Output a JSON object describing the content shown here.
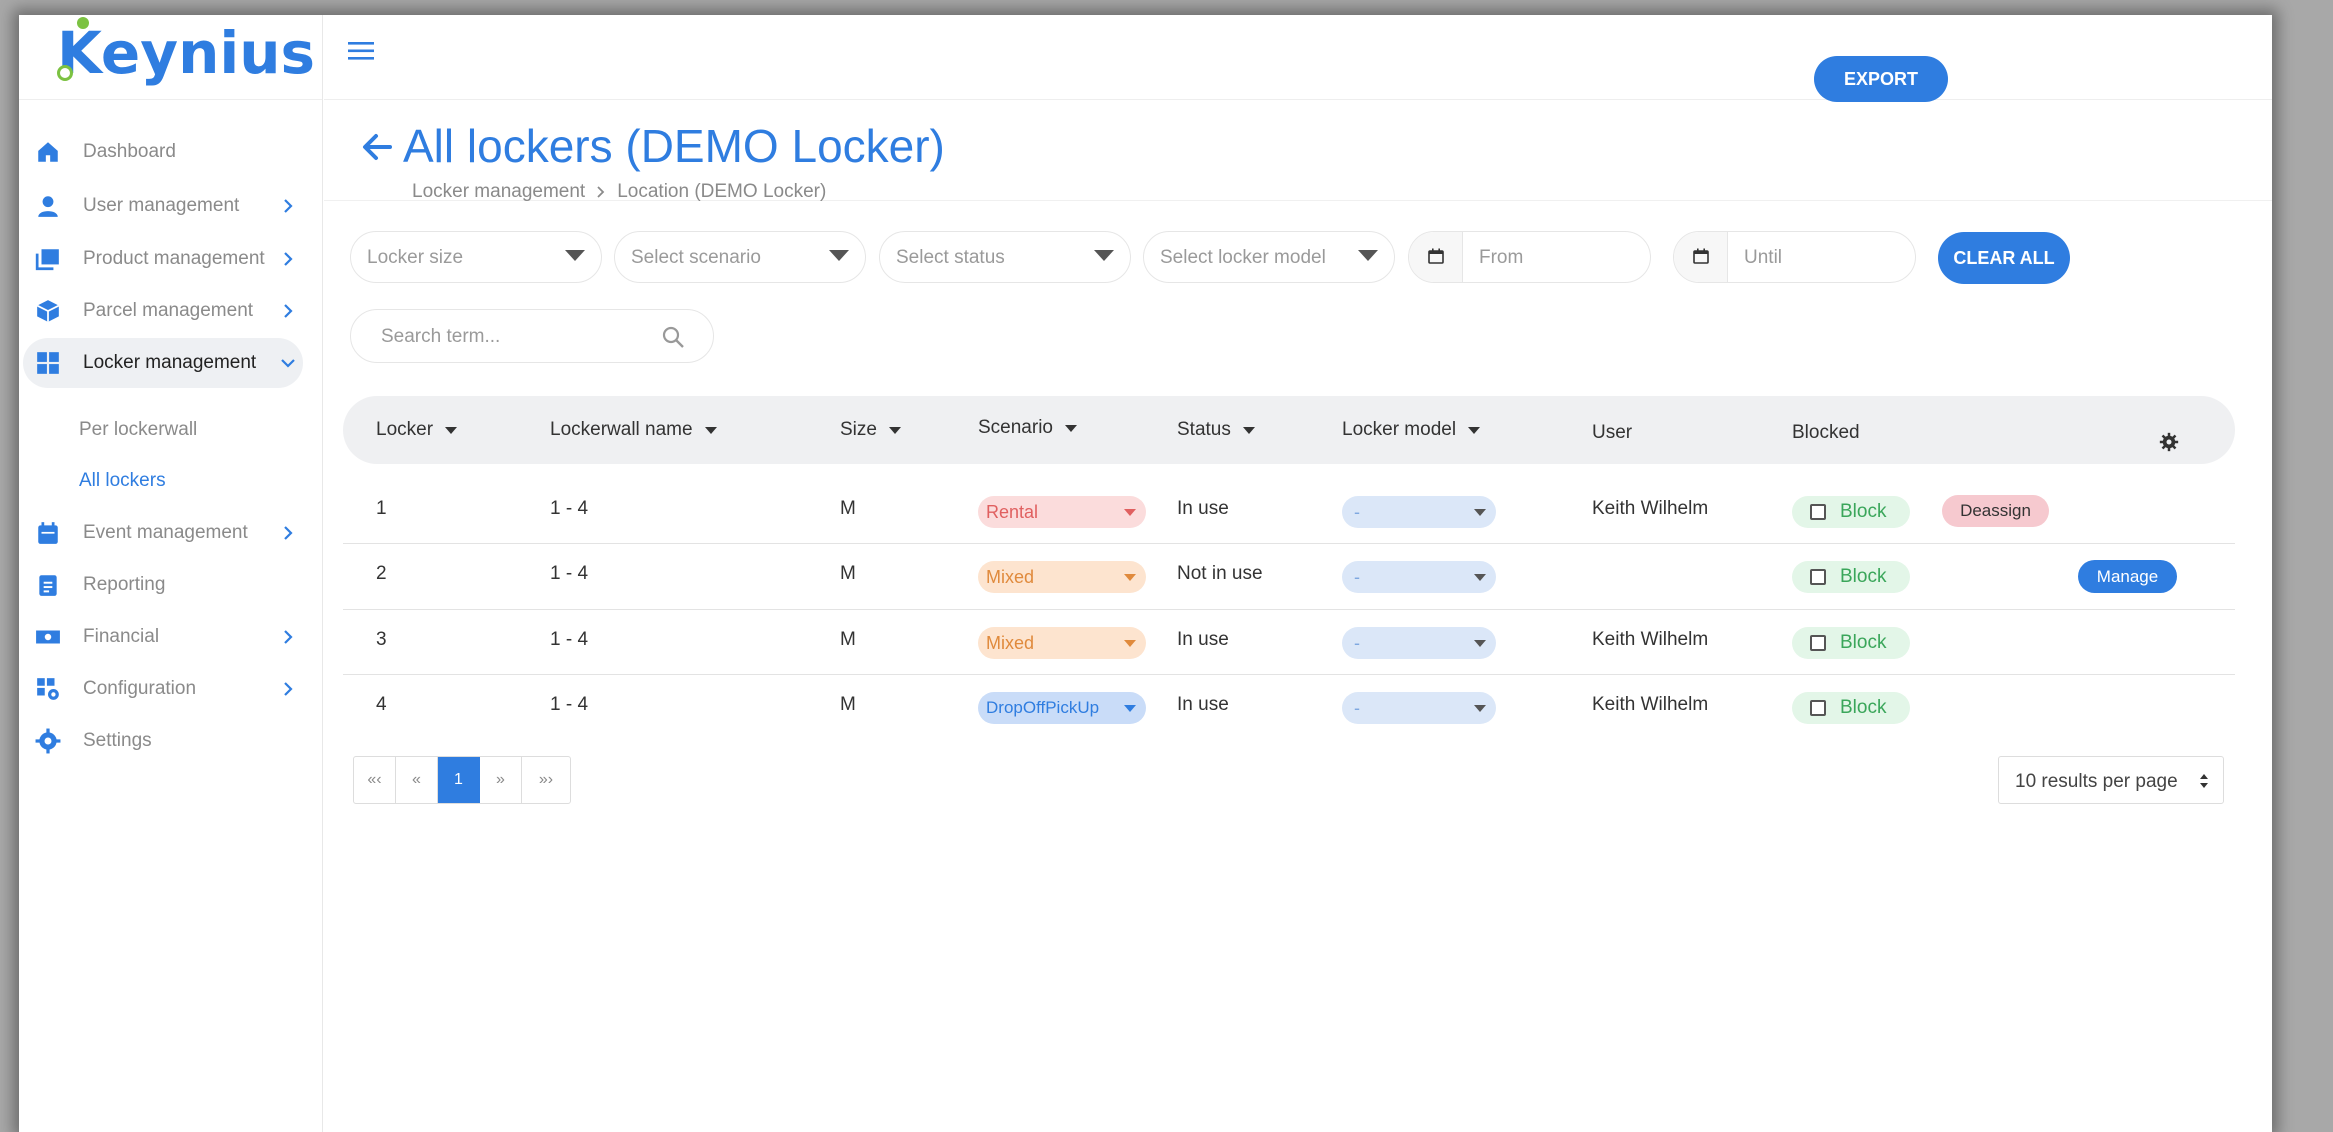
{
  "logo": {
    "text": "Keynius"
  },
  "sidebar": {
    "items": [
      {
        "label": "Dashboard"
      },
      {
        "label": "User management"
      },
      {
        "label": "Product management"
      },
      {
        "label": "Parcel management"
      },
      {
        "label": "Locker management"
      },
      {
        "label": "Event management"
      },
      {
        "label": "Reporting"
      },
      {
        "label": "Financial"
      },
      {
        "label": "Configuration"
      },
      {
        "label": "Settings"
      }
    ],
    "subitems": [
      {
        "label": "Per lockerwall"
      },
      {
        "label": "All lockers"
      }
    ]
  },
  "header": {
    "title": "All lockers (DEMO Locker)",
    "breadcrumb": [
      "Locker management",
      "Location (DEMO Locker)"
    ],
    "export_label": "EXPORT"
  },
  "filters": {
    "locker_size": "Locker size",
    "scenario": "Select scenario",
    "status": "Select status",
    "locker_model": "Select locker model",
    "from": "From",
    "until": "Until",
    "clear_label": "CLEAR ALL",
    "search_placeholder": "Search term..."
  },
  "table": {
    "headers": {
      "locker": "Locker",
      "lockerwall": "Lockerwall name",
      "size": "Size",
      "scenario": "Scenario",
      "status": "Status",
      "model": "Locker model",
      "user": "User",
      "blocked": "Blocked"
    },
    "rows": [
      {
        "locker": "1",
        "lockerwall": "1 - 4",
        "size": "M",
        "scenario": "Rental",
        "status": "In use",
        "model": "-",
        "user": "Keith Wilhelm",
        "block": "Block"
      },
      {
        "locker": "2",
        "lockerwall": "1 - 4",
        "size": "M",
        "scenario": "Mixed",
        "status": "Not in use",
        "model": "-",
        "user": "",
        "block": "Block"
      },
      {
        "locker": "3",
        "lockerwall": "1 - 4",
        "size": "M",
        "scenario": "Mixed",
        "status": "In use",
        "model": "-",
        "user": "Keith Wilhelm",
        "block": "Block"
      },
      {
        "locker": "4",
        "lockerwall": "1 - 4",
        "size": "M",
        "scenario": "DropOffPickUp",
        "status": "In use",
        "model": "-",
        "user": "Keith Wilhelm",
        "block": "Block"
      }
    ],
    "deassign_label": "Deassign",
    "manage_label": "Manage"
  },
  "pagination": {
    "first": "«‹",
    "prev": "«",
    "current": "1",
    "next": "»",
    "last": "»›",
    "per_page": "10 results per page"
  },
  "colors": {
    "primary": "#2f7de0",
    "rental": "#e06060",
    "mixed": "#e08a3c",
    "block_green": "#3aa65a"
  }
}
